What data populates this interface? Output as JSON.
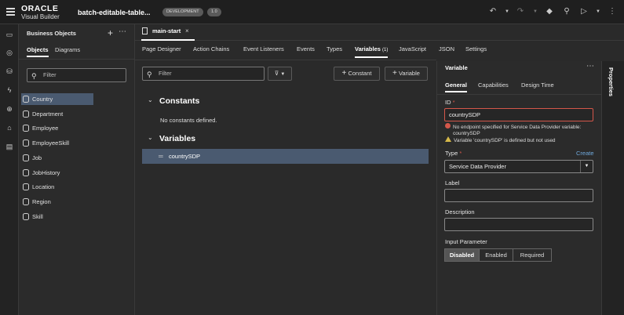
{
  "header": {
    "logo_brand": "ORACLE",
    "logo_product": "Visual Builder",
    "app_name": "batch-editable-table...",
    "env_badge": "DEVELOPMENT",
    "version_badge": "1.0"
  },
  "business_objects": {
    "title": "Business Objects",
    "tabs": [
      {
        "label": "Objects"
      },
      {
        "label": "Diagrams"
      }
    ],
    "filter_placeholder": "Filter",
    "items": [
      {
        "label": "Country"
      },
      {
        "label": "Department"
      },
      {
        "label": "Employee"
      },
      {
        "label": "EmployeeSkill"
      },
      {
        "label": "Job"
      },
      {
        "label": "JobHistory"
      },
      {
        "label": "Location"
      },
      {
        "label": "Region"
      },
      {
        "label": "Skill"
      }
    ]
  },
  "editor": {
    "file_tab": "main-start",
    "subtabs": [
      {
        "label": "Page Designer"
      },
      {
        "label": "Action Chains"
      },
      {
        "label": "Event Listeners"
      },
      {
        "label": "Events"
      },
      {
        "label": "Types"
      },
      {
        "label": "Variables",
        "count": "(1)"
      },
      {
        "label": "JavaScript"
      },
      {
        "label": "JSON"
      },
      {
        "label": "Settings"
      }
    ],
    "filter_placeholder": "Filter",
    "add_constant_label": "Constant",
    "add_variable_label": "Variable",
    "constants_title": "Constants",
    "no_constants_text": "No constants defined.",
    "variables_title": "Variables",
    "variables": [
      {
        "name": "countrySDP"
      }
    ]
  },
  "properties": {
    "heading": "Variable",
    "tabs": [
      {
        "label": "General"
      },
      {
        "label": "Capabilities"
      },
      {
        "label": "Design Time"
      }
    ],
    "id_label": "ID",
    "id_value": "countrySDP",
    "error_message_line1": "No endpoint specified for Service Data Provider variable:",
    "error_message_line2": "countrySDP",
    "warning_message": "Variable 'countrySDP' is defined but not used",
    "type_label": "Type",
    "type_create": "Create",
    "type_value": "Service Data Provider",
    "label_label": "Label",
    "label_value": "",
    "description_label": "Description",
    "description_value": "",
    "input_parameter_label": "Input Parameter",
    "input_parameter_options": [
      {
        "label": "Disabled"
      },
      {
        "label": "Enabled"
      },
      {
        "label": "Required"
      }
    ],
    "input_parameter_selected": "Disabled",
    "side_strip_label": "Properties"
  },
  "colors": {
    "selection": "#4a5a70",
    "error": "#d4574a",
    "warning": "#d6b94a",
    "link": "#6fa8dc"
  }
}
